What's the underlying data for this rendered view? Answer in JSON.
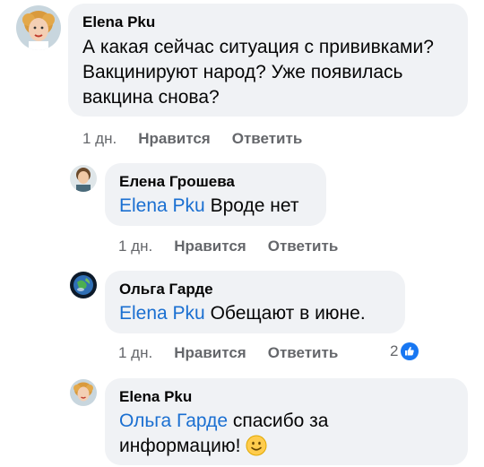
{
  "comments": [
    {
      "author": "Elena Pku",
      "text": "А какая сейчас ситуация с прививками? Вакцинируют народ? Уже появилась вакцина снова?",
      "time": "1 дн.",
      "like_label": "Нравится",
      "reply_label": "Ответить"
    },
    {
      "author": "Елена Грошева",
      "mention": "Elena Pku",
      "text": "Вроде нет",
      "time": "1 дн.",
      "like_label": "Нравится",
      "reply_label": "Ответить"
    },
    {
      "author": "Ольга Гарде",
      "mention": "Elena Pku",
      "text": "Обещают в июне.",
      "time": "1 дн.",
      "like_label": "Нравится",
      "reply_label": "Ответить",
      "reaction_count": "2"
    },
    {
      "author": "Elena Pku",
      "mention": "Ольга Гарде",
      "text": "спасибо за информацию!",
      "emoji": "🙂"
    }
  ],
  "colors": {
    "bubble": "#f0f2f5",
    "mention": "#1a6fd1",
    "meta": "#65676b",
    "like_blue": "#1877f2"
  },
  "icons": {
    "reaction": "like-thumb-icon",
    "emoji": "smiley-face-icon"
  }
}
